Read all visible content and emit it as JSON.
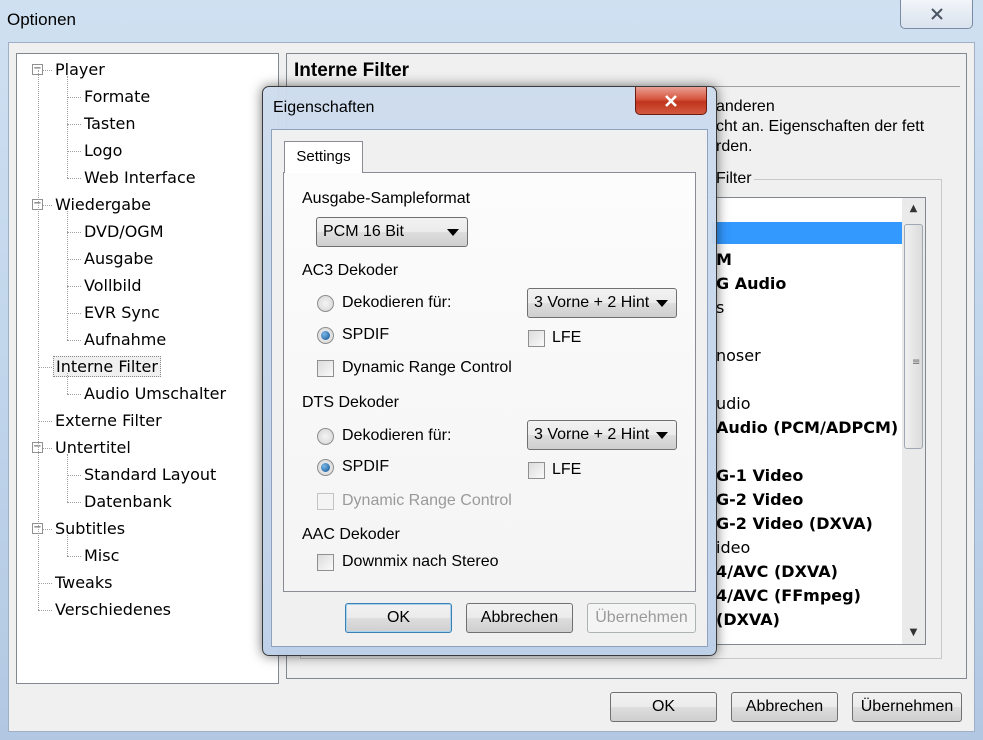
{
  "window": {
    "title": "Optionen",
    "close_label": "X"
  },
  "tree": {
    "items": [
      {
        "label": "Player",
        "level": 0,
        "expanded": true
      },
      {
        "label": "Formate",
        "level": 1
      },
      {
        "label": "Tasten",
        "level": 1
      },
      {
        "label": "Logo",
        "level": 1
      },
      {
        "label": "Web Interface",
        "level": 1
      },
      {
        "label": "Wiedergabe",
        "level": 0,
        "expanded": true
      },
      {
        "label": "DVD/OGM",
        "level": 1
      },
      {
        "label": "Ausgabe",
        "level": 1
      },
      {
        "label": "Vollbild",
        "level": 1
      },
      {
        "label": "EVR Sync",
        "level": 1
      },
      {
        "label": "Aufnahme",
        "level": 1
      },
      {
        "label": "Interne Filter",
        "level": 0,
        "selected": true
      },
      {
        "label": "Audio Umschalter",
        "level": 1
      },
      {
        "label": "Externe Filter",
        "level": 0
      },
      {
        "label": "Untertitel",
        "level": 0,
        "expanded": true
      },
      {
        "label": "Standard Layout",
        "level": 1
      },
      {
        "label": "Datenbank",
        "level": 1
      },
      {
        "label": "Subtitles",
        "level": 0,
        "expanded": true
      },
      {
        "label": "Misc",
        "level": 1
      },
      {
        "label": "Tweaks",
        "level": 0
      },
      {
        "label": "Verschiedenes",
        "level": 0
      }
    ]
  },
  "panel": {
    "heading": "Interne Filter",
    "description_lines": [
      "anderen",
      "cht an. Eigenschaften der fett",
      "rden."
    ],
    "group_label": "Filter",
    "filter_items": [
      {
        "text": "",
        "bold": false,
        "selected": true
      },
      {
        "text": "",
        "bold": false
      },
      {
        "text": "M",
        "bold": true
      },
      {
        "text": "G Audio",
        "bold": true
      },
      {
        "text": "s",
        "bold": false
      },
      {
        "text": "",
        "bold": false
      },
      {
        "text": "noser",
        "bold": false
      },
      {
        "text": "",
        "bold": false
      },
      {
        "text": "udio",
        "bold": false
      },
      {
        "text": "Audio (PCM/ADPCM)",
        "bold": true
      },
      {
        "text": "",
        "bold": false
      },
      {
        "text": "G-1 Video",
        "bold": true
      },
      {
        "text": "G-2 Video",
        "bold": true
      },
      {
        "text": "G-2 Video (DXVA)",
        "bold": true
      },
      {
        "text": "ideo",
        "bold": false
      },
      {
        "text": "4/AVC (DXVA)",
        "bold": true
      },
      {
        "text": "4/AVC (FFmpeg)",
        "bold": true
      },
      {
        "text": "(DXVA)",
        "bold": true
      }
    ]
  },
  "bottom_buttons": {
    "ok": "OK",
    "cancel": "Abbrechen",
    "apply": "Übernehmen"
  },
  "dialog": {
    "title": "Eigenschaften",
    "tab": "Settings",
    "sample_format_label": "Ausgabe-Sampleformat",
    "sample_format_value": "PCM 16 Bit",
    "ac3": {
      "title": "AC3 Dekoder",
      "decode_for_label": "Dekodieren für:",
      "channels_value": "3 Vorne + 2 Hint",
      "spdif_label": "SPDIF",
      "lfe_label": "LFE",
      "drc_label": "Dynamic Range Control"
    },
    "dts": {
      "title": "DTS Dekoder",
      "decode_for_label": "Dekodieren für:",
      "channels_value": "3 Vorne + 2 Hint",
      "spdif_label": "SPDIF",
      "lfe_label": "LFE",
      "drc_label": "Dynamic Range Control"
    },
    "aac": {
      "title": "AAC Dekoder",
      "downmix_label": "Downmix nach Stereo"
    },
    "buttons": {
      "ok": "OK",
      "cancel": "Abbrechen",
      "apply": "Übernehmen"
    }
  }
}
